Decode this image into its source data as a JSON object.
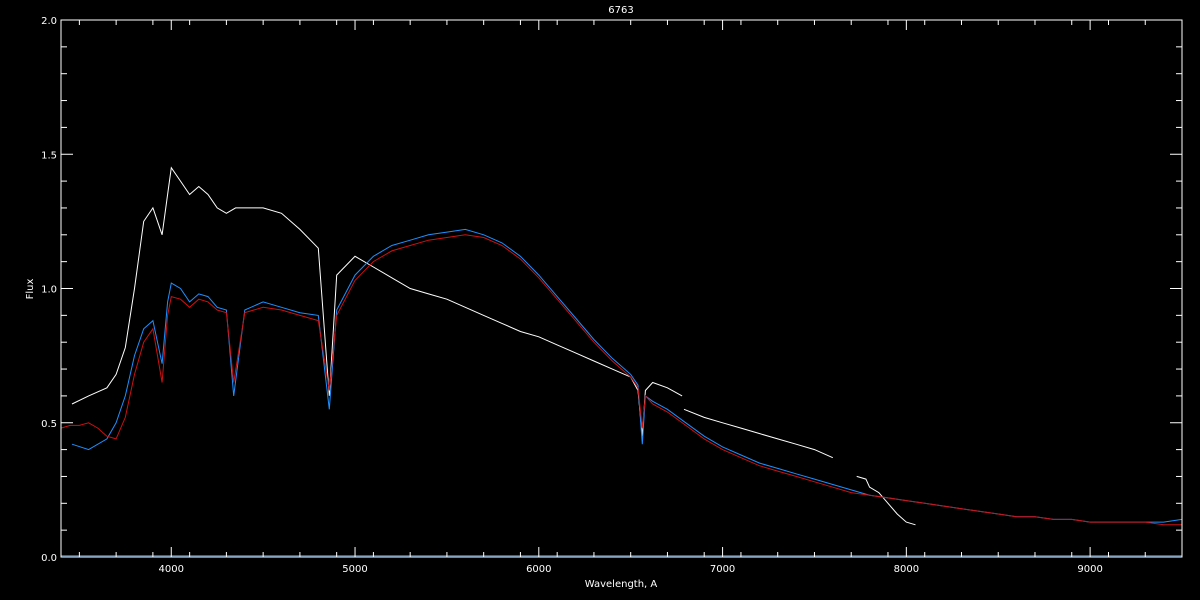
{
  "chart_data": {
    "type": "line",
    "title": "6763",
    "xlabel": "Wavelength, A",
    "ylabel": "Flux",
    "xlim": [
      3400,
      9500
    ],
    "ylim": [
      0.0,
      2.0
    ],
    "x_ticks": [
      {
        "value": 4000,
        "label": "4000"
      },
      {
        "value": 5000,
        "label": "5000"
      },
      {
        "value": 6000,
        "label": "6000"
      },
      {
        "value": 7000,
        "label": "7000"
      },
      {
        "value": 8000,
        "label": "8000"
      },
      {
        "value": 9000,
        "label": "9000"
      }
    ],
    "y_ticks": [
      {
        "value": 0.0,
        "label": "0.0"
      },
      {
        "value": 0.5,
        "label": "0.5"
      },
      {
        "value": 1.0,
        "label": "1.0"
      },
      {
        "value": 1.5,
        "label": "1.5"
      },
      {
        "value": 2.0,
        "label": "2.0"
      }
    ],
    "grid": false,
    "background": "#000000",
    "series": [
      {
        "color": "#ffffff",
        "x": [
          3460,
          3550,
          3650,
          3700,
          3750,
          3800,
          3850,
          3900,
          3950,
          3980,
          4000,
          4050,
          4100,
          4150,
          4200,
          4250,
          4300,
          4350,
          4400,
          4500,
          4600,
          4700,
          4800,
          4860,
          4900,
          5000,
          5100,
          5200,
          5300,
          5400,
          5500,
          5600,
          5700,
          5800,
          5900,
          6000,
          6100,
          6200,
          6300,
          6400,
          6500,
          6540,
          6563,
          6580,
          6620,
          6700,
          6780
        ],
        "y": [
          0.57,
          0.6,
          0.63,
          0.68,
          0.78,
          1.0,
          1.25,
          1.3,
          1.2,
          1.35,
          1.45,
          1.4,
          1.35,
          1.38,
          1.35,
          1.3,
          1.28,
          1.3,
          1.3,
          1.3,
          1.28,
          1.22,
          1.15,
          0.6,
          1.05,
          1.12,
          1.08,
          1.04,
          1.0,
          0.98,
          0.96,
          0.93,
          0.9,
          0.87,
          0.84,
          0.82,
          0.79,
          0.76,
          0.73,
          0.7,
          0.67,
          0.62,
          0.45,
          0.62,
          0.65,
          0.63,
          0.6
        ]
      },
      {
        "color": "#ffffff",
        "x": [
          6790,
          6900,
          7000,
          7100,
          7200,
          7300,
          7400,
          7500,
          7600
        ],
        "y": [
          0.55,
          0.52,
          0.5,
          0.48,
          0.46,
          0.44,
          0.42,
          0.4,
          0.37
        ]
      },
      {
        "color": "#ffffff",
        "x": [
          7730,
          7780,
          7800,
          7850,
          7900,
          7950,
          8000,
          8050
        ],
        "y": [
          0.3,
          0.29,
          0.26,
          0.24,
          0.2,
          0.16,
          0.13,
          0.12
        ]
      },
      {
        "color": "#1e90ff",
        "x": [
          3460,
          3550,
          3650,
          3700,
          3750,
          3800,
          3850,
          3900,
          3950,
          3980,
          4000,
          4050,
          4100,
          4150,
          4200,
          4250,
          4300,
          4340,
          4400,
          4500,
          4600,
          4700,
          4800,
          4860,
          4900,
          5000,
          5100,
          5200,
          5300,
          5400,
          5500,
          5600,
          5700,
          5800,
          5900,
          6000,
          6100,
          6200,
          6300,
          6400,
          6500,
          6540,
          6563,
          6580,
          6620,
          6700,
          6800,
          6900,
          7000,
          7100,
          7200,
          7300,
          7400,
          7500,
          7600,
          7700,
          7800,
          7900,
          8000,
          8100,
          8200,
          8300,
          8400,
          8500,
          8600,
          8700,
          8800,
          8900,
          9000,
          9100,
          9200,
          9300,
          9400,
          9500
        ],
        "y": [
          0.42,
          0.4,
          0.44,
          0.5,
          0.6,
          0.75,
          0.85,
          0.88,
          0.72,
          0.95,
          1.02,
          1.0,
          0.95,
          0.98,
          0.97,
          0.93,
          0.92,
          0.6,
          0.92,
          0.95,
          0.93,
          0.91,
          0.9,
          0.55,
          0.92,
          1.05,
          1.12,
          1.16,
          1.18,
          1.2,
          1.21,
          1.22,
          1.2,
          1.17,
          1.12,
          1.05,
          0.97,
          0.89,
          0.81,
          0.74,
          0.68,
          0.64,
          0.42,
          0.6,
          0.58,
          0.55,
          0.5,
          0.45,
          0.41,
          0.38,
          0.35,
          0.33,
          0.31,
          0.29,
          0.27,
          0.25,
          0.23,
          0.22,
          0.21,
          0.2,
          0.19,
          0.18,
          0.17,
          0.16,
          0.15,
          0.15,
          0.14,
          0.14,
          0.13,
          0.13,
          0.13,
          0.13,
          0.13,
          0.14
        ]
      },
      {
        "color": "#cc1111",
        "x": [
          3400,
          3450,
          3500,
          3550,
          3600,
          3650,
          3700,
          3750,
          3800,
          3850,
          3900,
          3950,
          3980,
          4000,
          4050,
          4100,
          4150,
          4200,
          4250,
          4300,
          4340,
          4400,
          4500,
          4600,
          4700,
          4800,
          4860,
          4900,
          5000,
          5100,
          5200,
          5300,
          5400,
          5500,
          5600,
          5700,
          5800,
          5900,
          6000,
          6100,
          6200,
          6300,
          6400,
          6500,
          6540,
          6563,
          6580,
          6620,
          6700,
          6800,
          6900,
          7000,
          7100,
          7200,
          7300,
          7400,
          7500,
          7600,
          7700,
          7800,
          7900,
          8000,
          8100,
          8200,
          8300,
          8400,
          8500,
          8600,
          8700,
          8800,
          8900,
          9000,
          9100,
          9200,
          9300,
          9400,
          9500
        ],
        "y": [
          0.48,
          0.49,
          0.49,
          0.5,
          0.48,
          0.45,
          0.44,
          0.52,
          0.68,
          0.8,
          0.85,
          0.65,
          0.9,
          0.97,
          0.96,
          0.93,
          0.96,
          0.95,
          0.92,
          0.91,
          0.65,
          0.91,
          0.93,
          0.92,
          0.9,
          0.88,
          0.62,
          0.9,
          1.03,
          1.1,
          1.14,
          1.16,
          1.18,
          1.19,
          1.2,
          1.19,
          1.16,
          1.11,
          1.04,
          0.96,
          0.88,
          0.8,
          0.73,
          0.67,
          0.63,
          0.48,
          0.6,
          0.57,
          0.54,
          0.49,
          0.44,
          0.4,
          0.37,
          0.34,
          0.32,
          0.3,
          0.28,
          0.26,
          0.24,
          0.23,
          0.22,
          0.21,
          0.2,
          0.19,
          0.18,
          0.17,
          0.16,
          0.15,
          0.15,
          0.14,
          0.14,
          0.13,
          0.13,
          0.13,
          0.13,
          0.12,
          0.12
        ]
      },
      {
        "color": "#1e90ff",
        "x": [
          3400,
          9500
        ],
        "y": [
          0.005,
          0.005
        ]
      }
    ]
  }
}
